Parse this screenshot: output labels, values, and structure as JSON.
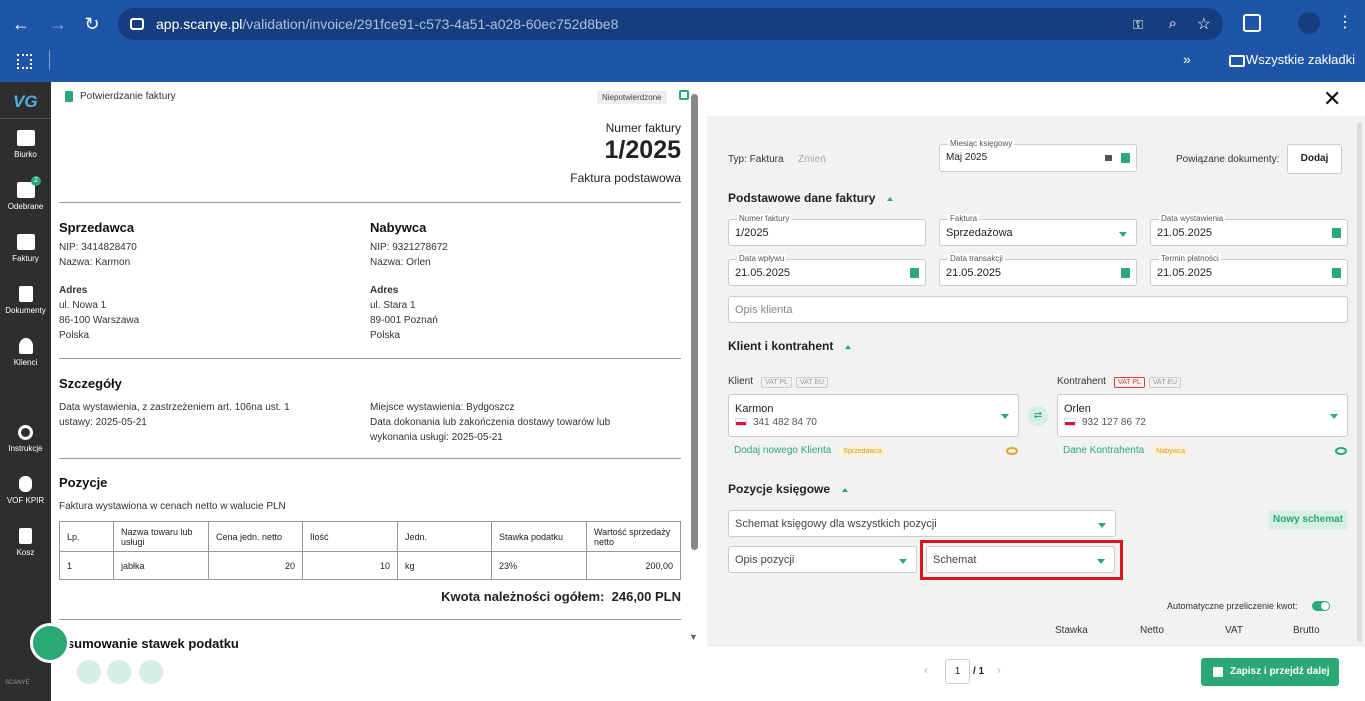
{
  "browser": {
    "url_host": "app.scanye.pl",
    "url_path": "/validation/invoice/291fce91-c573-4a51-a028-60ec752d8be8",
    "bookmarks_label": "Wszystkie zakładki"
  },
  "sidebar": {
    "logo": "VG",
    "items": [
      {
        "label": "Biurko",
        "icon": "desk-icon"
      },
      {
        "label": "Odebrane",
        "icon": "inbox-icon",
        "badge": "2"
      },
      {
        "label": "Faktury",
        "icon": "folder-icon"
      },
      {
        "label": "Dokumenty",
        "icon": "document-icon"
      },
      {
        "label": "Klienci",
        "icon": "user-icon"
      },
      {
        "label": "Instrukcje",
        "icon": "lifebuoy-icon"
      },
      {
        "label": "VOF KPIR",
        "icon": "database-icon"
      },
      {
        "label": "Kosz",
        "icon": "trash-icon"
      }
    ],
    "brand": "SCANYE"
  },
  "invoice": {
    "breadcrumb": "Potwierdzanie faktury",
    "status": "Niepotwierdzone",
    "number_label": "Numer faktury",
    "number": "1/2025",
    "type": "Faktura podstawowa",
    "seller": {
      "heading": "Sprzedawca",
      "nip": "NIP: 3414828470",
      "name": "Nazwa: Karmon",
      "addr_label": "Adres",
      "addr1": "ul. Nowa 1",
      "addr2": "86-100 Warszawa",
      "country": "Polska"
    },
    "buyer": {
      "heading": "Nabywca",
      "nip": "NIP: 9321278672",
      "name": "Nazwa: Orlen",
      "addr_label": "Adres",
      "addr1": "ul. Stara 1",
      "addr2": "89-001 Poznań",
      "country": "Polska"
    },
    "details": {
      "heading": "Szczegóły",
      "left": "Data wystawienia, z zastrzeżeniem art. 106na ust. 1 ustawy: 2025-05-21",
      "right1": "Miejsce wystawienia: Bydgoszcz",
      "right2": "Data dokonania lub zakończenia dostawy towarów lub wykonania usługi: 2025-05-21"
    },
    "positions": {
      "heading": "Pozycje",
      "note": "Faktura wystawiona w cenach netto w walucie PLN",
      "headers": [
        "Lp.",
        "Nazwa towaru lub usługi",
        "Cena jedn. netto",
        "Ilość",
        "Jedn.",
        "Stawka podatku",
        "Wartość sprzedaży netto"
      ],
      "rows": [
        [
          "1",
          "jabłka",
          "20",
          "10",
          "kg",
          "23%",
          "200,00"
        ]
      ]
    },
    "total_label": "Kwota należności ogółem:",
    "total_value": "246,00 PLN",
    "summary_heading": "dsumowanie stawek podatku"
  },
  "form": {
    "type_label": "Typ: Faktura",
    "change_link": "Zmień",
    "month_label": "Miesiąc księgowy",
    "month_value": "Maj 2025",
    "related_label": "Powiązane dokumenty:",
    "add_button": "Dodaj",
    "basic_section": "Podstawowe dane faktury",
    "fields": {
      "number": {
        "label": "Numer faktury",
        "value": "1/2025"
      },
      "invoice_kind": {
        "label": "Faktura",
        "value": "Sprzedażowa"
      },
      "issue_date": {
        "label": "Data wystawienia",
        "value": "21.05.2025"
      },
      "receipt_date": {
        "label": "Data wpływu",
        "value": "21.05.2025"
      },
      "transaction_date": {
        "label": "Data transakcji",
        "value": "21.05.2025"
      },
      "due_date": {
        "label": "Termin płatności",
        "value": "21.05.2025"
      }
    },
    "client_desc_placeholder": "Opis klienta",
    "client_section": "Klient i kontrahent",
    "client_label": "Klient",
    "contractor_label": "Kontrahent",
    "vat_pl": "VAT PL",
    "vat_eu": "VAT EU",
    "client_name": "Karmon",
    "client_nip": "341 482 84 70",
    "contractor_name": "Orlen",
    "contractor_nip": "932 127 86 72",
    "add_client": "Dodaj nowego Klienta",
    "seller_tag": "Sprzedawca",
    "contractor_data": "Dane Kontrahenta",
    "buyer_tag": "Nabywca",
    "booking_section": "Pozycje księgowe",
    "schema_all_placeholder": "Schemat księgowy dla wszystkich pozycji",
    "new_schema_button": "Nowy schemat",
    "position_desc_placeholder": "Opis pozycji",
    "schema_placeholder": "Schemat",
    "auto_calc_label": "Automatyczne przeliczenie kwot:",
    "cols": [
      "Stawka",
      "Netto",
      "VAT",
      "Brutto"
    ],
    "page_current": "1",
    "page_total": "/ 1",
    "save_button": "Zapisz i przejdź dalej"
  },
  "colors": {
    "accent": "#2aa876",
    "highlight": "#d9161c",
    "browser": "#1f55a8"
  }
}
